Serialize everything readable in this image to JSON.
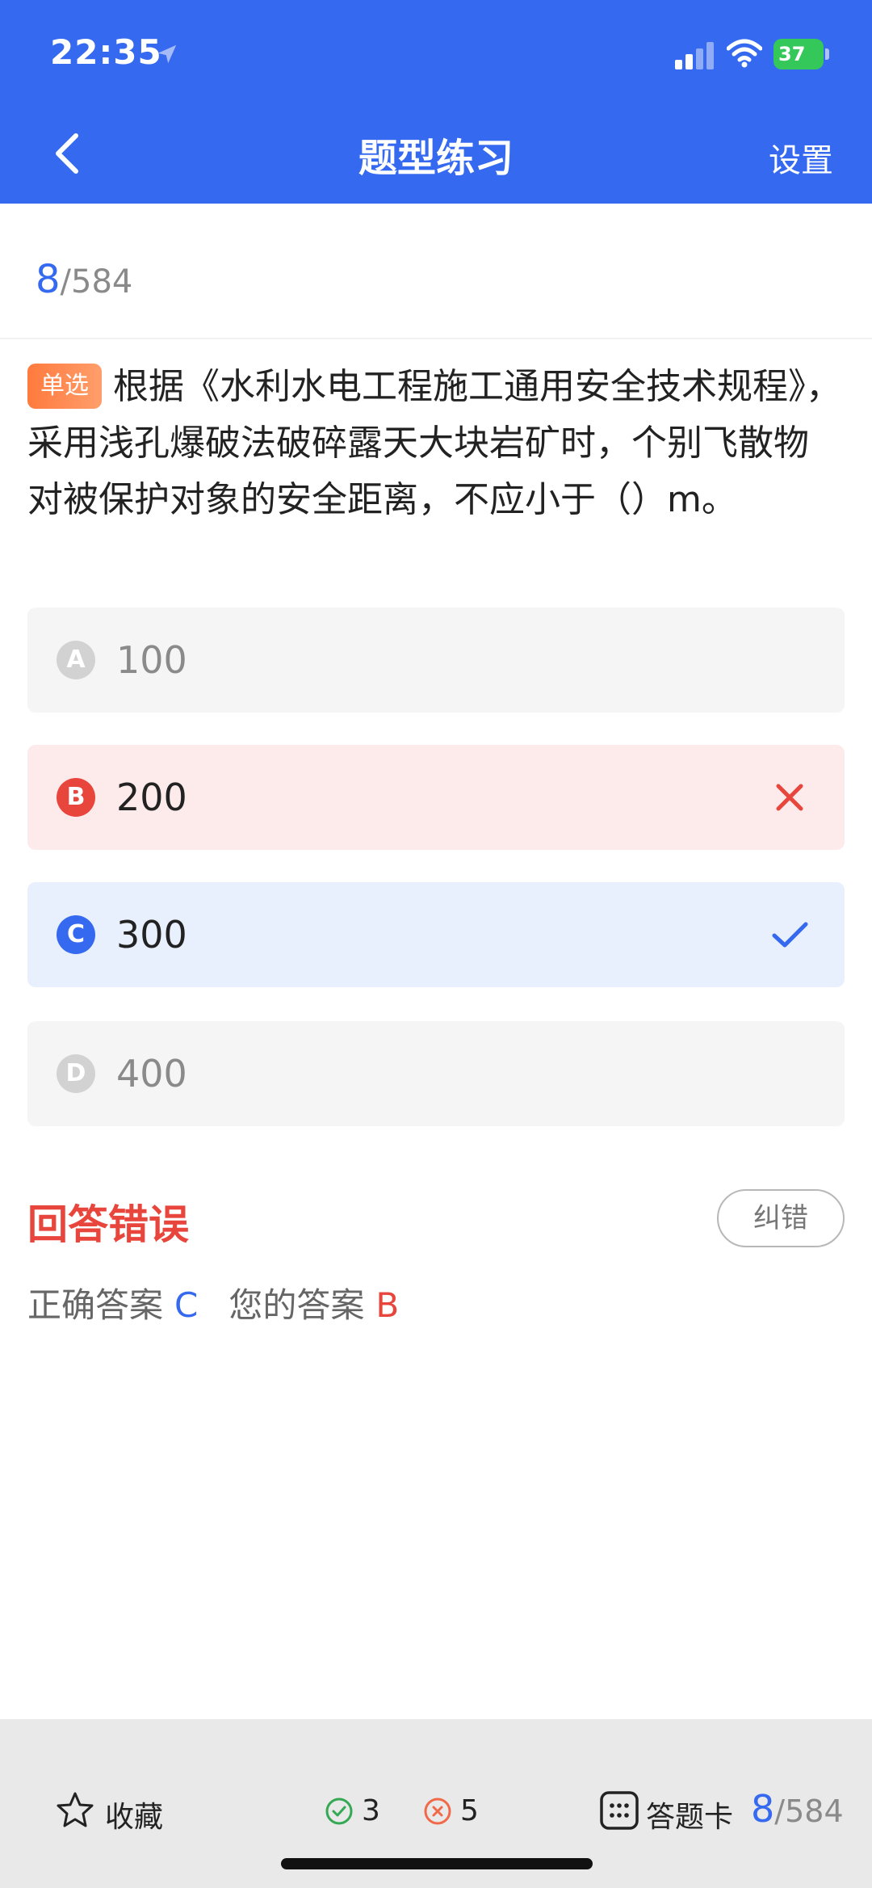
{
  "status_bar": {
    "time": "22:35",
    "battery": "37"
  },
  "nav": {
    "title": "题型练习",
    "settings_label": "设置"
  },
  "counter": {
    "current": "8",
    "total": "/584"
  },
  "question": {
    "type_badge": "单选",
    "text": "根据《水利水电工程施工通用安全技术规程》，采用浅孔爆破法破碎露天大块岩矿时，个别飞散物对被保护对象的安全距离，不应小于（）m。"
  },
  "options": [
    {
      "letter": "A",
      "text": "100",
      "state": "neutral"
    },
    {
      "letter": "B",
      "text": "200",
      "state": "wrong"
    },
    {
      "letter": "C",
      "text": "300",
      "state": "correct"
    },
    {
      "letter": "D",
      "text": "400",
      "state": "neutral"
    }
  ],
  "result": {
    "title": "回答错误",
    "report_label": "纠错",
    "correct_label": "正确答案",
    "correct_value": "C",
    "yours_label": "您的答案",
    "yours_value": "B"
  },
  "bottom_bar": {
    "favorite_label": "收藏",
    "correct_count": "3",
    "wrong_count": "5",
    "answer_card_label": "答题卡",
    "current": "8",
    "total": "/584"
  },
  "colors": {
    "primary": "#3569F0",
    "error": "#E8453C",
    "success": "#34A853",
    "badge": "#FF7A3D"
  },
  "icons": [
    "location-arrow-icon",
    "signal-icon",
    "wifi-icon",
    "battery-icon",
    "back-chevron-icon",
    "cross-icon",
    "check-icon",
    "star-icon",
    "check-circle-icon",
    "x-circle-icon",
    "grid-icon"
  ]
}
